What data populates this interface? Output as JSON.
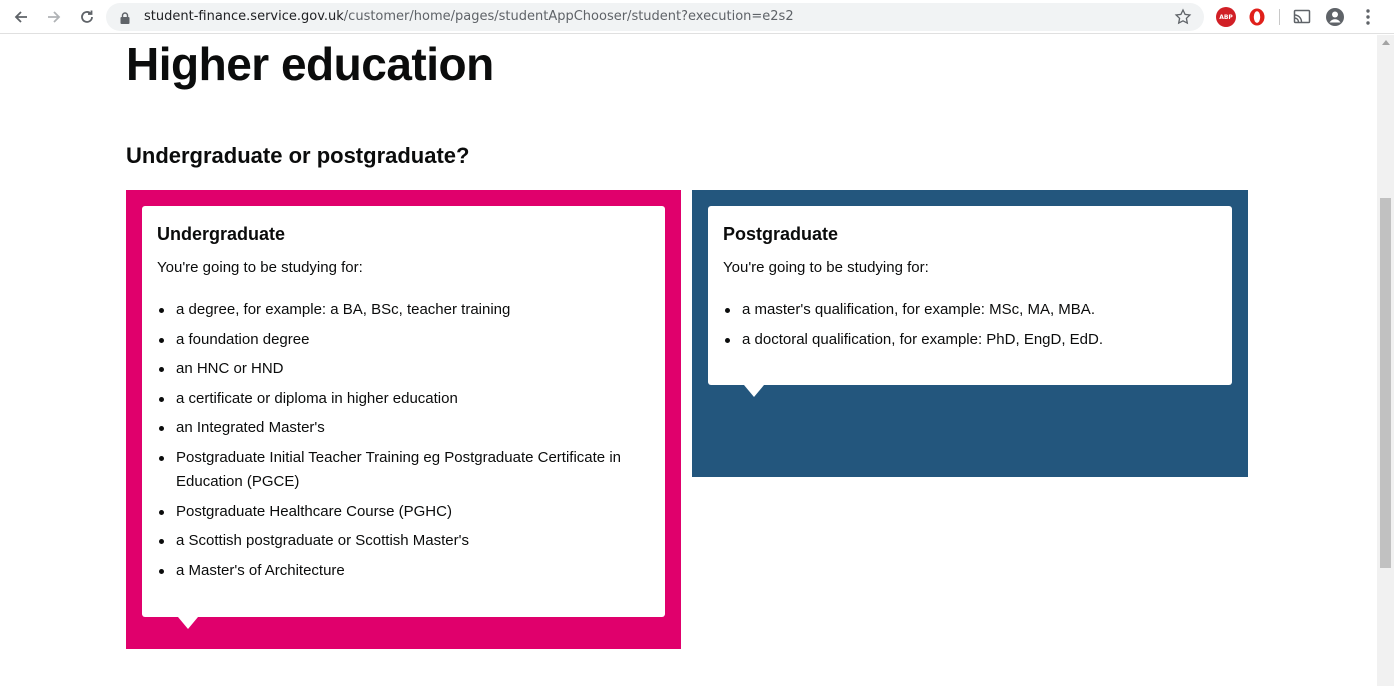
{
  "browser": {
    "url_host": "student-finance.service.gov.uk",
    "url_path": "/customer/home/pages/studentAppChooser/student?execution=e2s2",
    "icons": [
      "back-arrow-icon",
      "forward-arrow-icon",
      "reload-icon",
      "lock-icon",
      "star-icon",
      "adblock-icon",
      "opera-icon",
      "cast-icon",
      "profile-icon",
      "more-menu-icon"
    ],
    "adblock_label": "ABP",
    "adblock_color": "#d11f26",
    "opera_color": "#e0201b"
  },
  "page": {
    "title": "Higher education",
    "question": "Undergraduate or postgraduate?"
  },
  "options": {
    "undergraduate": {
      "accent": "#e0006c",
      "heading": "Undergraduate",
      "intro": "You're going to be studying for:",
      "items": [
        "a degree, for example: a BA, BSc, teacher training",
        "a foundation degree",
        "an HNC or HND",
        "a certificate or diploma in higher education",
        "an Integrated Master's",
        "Postgraduate Initial Teacher Training eg Postgraduate Certificate in Education (PGCE)",
        "Postgraduate Healthcare Course (PGHC)",
        "a Scottish postgraduate or Scottish Master's",
        "a Master's of Architecture"
      ]
    },
    "postgraduate": {
      "accent": "#23567d",
      "heading": "Postgraduate",
      "intro": "You're going to be studying for:",
      "items": [
        "a master's qualification, for example: MSc, MA, MBA.",
        "a doctoral qualification, for example: PhD, EngD, EdD."
      ]
    }
  }
}
